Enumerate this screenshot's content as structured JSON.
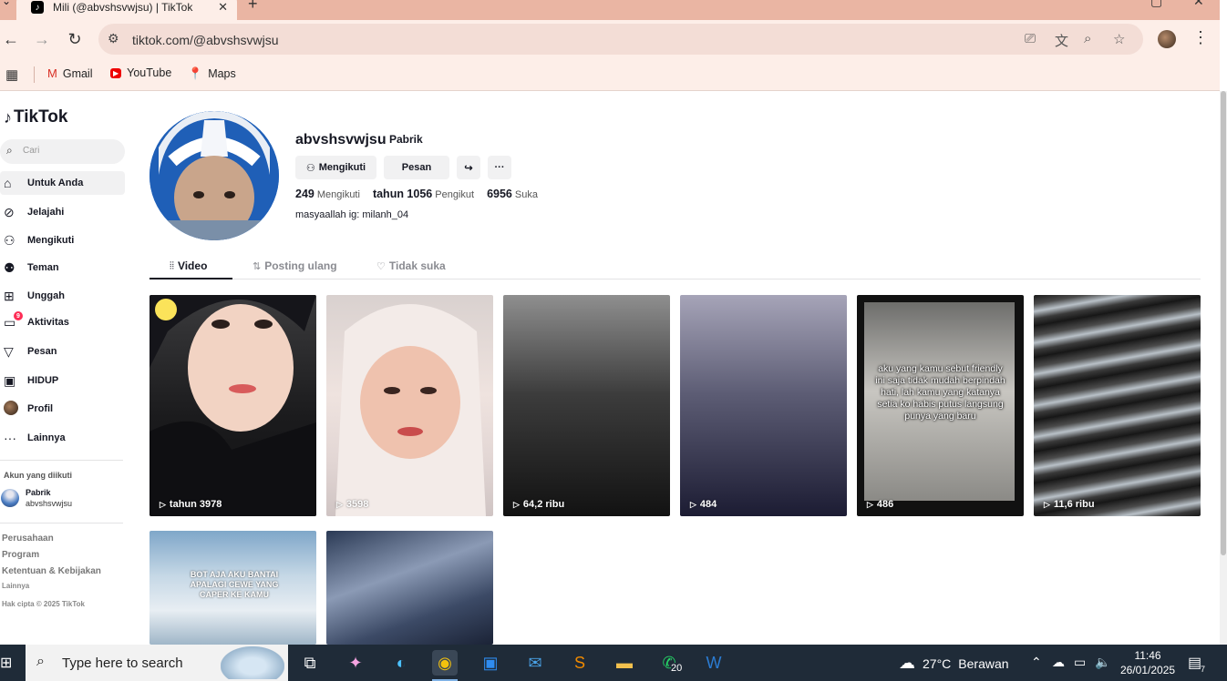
{
  "browser": {
    "tab_title": "Mili (@abvshsvwjsu) | TikTok",
    "url": "tiktok.com/@abvshsvwjsu",
    "bookmarks": [
      "Gmail",
      "YouTube",
      "Maps"
    ]
  },
  "sidebar": {
    "logo": "TikTok",
    "search_placeholder": "Cari",
    "nav": [
      {
        "label": "Untuk Anda",
        "icon": "home-icon"
      },
      {
        "label": "Jelajahi",
        "icon": "compass-icon"
      },
      {
        "label": "Mengikuti",
        "icon": "following-icon"
      },
      {
        "label": "Teman",
        "icon": "friends-icon"
      },
      {
        "label": "Unggah",
        "icon": "upload-icon"
      },
      {
        "label": "Aktivitas",
        "icon": "inbox-icon",
        "badge": "9"
      },
      {
        "label": "Pesan",
        "icon": "send-icon"
      },
      {
        "label": "HIDUP",
        "icon": "live-icon"
      },
      {
        "label": "Profil",
        "icon": "avatar"
      },
      {
        "label": "Lainnya",
        "icon": "more-icon"
      }
    ],
    "following_title": "Akun yang diikuti",
    "following": {
      "name": "Pabrik",
      "username": "abvshsvwjsu"
    },
    "footer": {
      "links": [
        "Perusahaan",
        "Program",
        "Ketentuan & Kebijakan"
      ],
      "more": "Lainnya",
      "copyright": "Hak cipta © 2025 TikTok"
    }
  },
  "profile": {
    "username": "abvshsvwjsu",
    "nickname": "Pabrik",
    "follow_button": "Mengikuti",
    "message_button": "Pesan",
    "stats": {
      "following_count": "249",
      "following_label": "Mengikuti",
      "followers_count": "tahun 1056",
      "followers_label": "Pengikut",
      "likes_count": "6956",
      "likes_label": "Suka"
    },
    "bio": "masyaallah ig: milanh_04",
    "tabs": [
      "Video",
      "Posting ulang",
      "Tidak suka"
    ]
  },
  "videos": [
    {
      "views": "tahun 3978"
    },
    {
      "views": "3598"
    },
    {
      "views": "64,2 ribu"
    },
    {
      "views": "484"
    },
    {
      "views": "486",
      "caption": "aku yang kamu sebut friendly ini saja tidak mudah berpindah hati, lah kamu yang katanya setia ko habis putus langsung punya yang baru"
    },
    {
      "views": "11,6 ribu"
    },
    {
      "views": "",
      "caption": "BOT AJA AKU BANTAI APALAGI CEWE YANG CAPER KE KAMU"
    },
    {
      "views": ""
    }
  ],
  "taskbar": {
    "search_text": "Type here to search",
    "whatsapp_badge": "20",
    "weather_temp": "27°C",
    "weather_desc": "Berawan",
    "time": "11:46",
    "date": "26/01/2025",
    "notifications": "7"
  }
}
